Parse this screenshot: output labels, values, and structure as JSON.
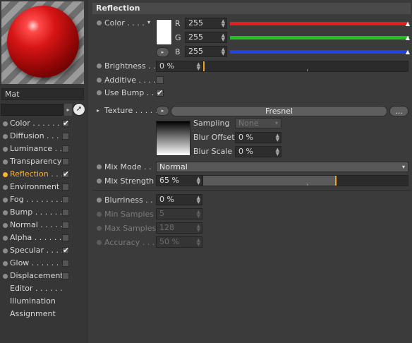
{
  "left": {
    "material_name": "Mat",
    "channels": [
      {
        "label": "Color . . . . . .",
        "checked": true,
        "active": false,
        "has_checkbox": true
      },
      {
        "label": "Diffusion . . .",
        "checked": false,
        "active": false,
        "has_checkbox": true
      },
      {
        "label": "Luminance . .",
        "checked": false,
        "active": false,
        "has_checkbox": true
      },
      {
        "label": "Transparency",
        "checked": false,
        "active": false,
        "has_checkbox": true
      },
      {
        "label": "Reflection . . .",
        "checked": true,
        "active": true,
        "has_checkbox": true
      },
      {
        "label": "Environment",
        "checked": false,
        "active": false,
        "has_checkbox": true
      },
      {
        "label": "Fog . . . . . . . .",
        "checked": false,
        "active": false,
        "has_checkbox": true
      },
      {
        "label": "Bump . . . . . .",
        "checked": false,
        "active": false,
        "has_checkbox": true
      },
      {
        "label": "Normal . . . . .",
        "checked": false,
        "active": false,
        "has_checkbox": true
      },
      {
        "label": "Alpha . . . . . .",
        "checked": false,
        "active": false,
        "has_checkbox": true
      },
      {
        "label": "Specular . . . .",
        "checked": true,
        "active": false,
        "has_checkbox": true
      },
      {
        "label": "Glow . . . . . . .",
        "checked": false,
        "active": false,
        "has_checkbox": true
      },
      {
        "label": "Displacement",
        "checked": false,
        "active": false,
        "has_checkbox": true
      },
      {
        "label": "Editor . . . . . .",
        "checked": false,
        "active": false,
        "has_checkbox": false
      },
      {
        "label": "Illumination",
        "checked": false,
        "active": false,
        "has_checkbox": false
      },
      {
        "label": "Assignment",
        "checked": false,
        "active": false,
        "has_checkbox": false
      }
    ]
  },
  "section": {
    "title": "Reflection"
  },
  "color": {
    "label": "Color . . . .",
    "swatch": "#ffffff",
    "r_label": "R",
    "r_value": "255",
    "g_label": "G",
    "g_value": "255",
    "b_label": "B",
    "b_value": "255",
    "r_color": "#e61e1e",
    "g_color": "#1fc21f",
    "b_color": "#2342e0"
  },
  "brightness": {
    "label": "Brightness . .",
    "value": "0 %",
    "level": 0
  },
  "additive": {
    "label": "Additive . . . .",
    "checked": false
  },
  "use_bump": {
    "label": "Use Bump . .",
    "checked": true
  },
  "texture": {
    "label": "Texture . . . . .",
    "shader": "Fresnel",
    "more": "...",
    "sampling_label": "Sampling",
    "sampling_value": "None",
    "blur_offset_label": "Blur Offset",
    "blur_offset_value": "0 %",
    "blur_scale_label": "Blur Scale",
    "blur_scale_value": "0 %"
  },
  "mix_mode": {
    "label": "Mix Mode . .",
    "value": "Normal"
  },
  "mix_strength": {
    "label": "Mix Strength",
    "value": "65 %",
    "level": 0.65
  },
  "blurriness": {
    "label": "Blurriness . . .",
    "value": "0 %"
  },
  "min_samples": {
    "label": "Min Samples",
    "value": "5"
  },
  "max_samples": {
    "label": "Max Samples",
    "value": "128"
  },
  "accuracy": {
    "label": "Accuracy . . . .",
    "value": "50 %"
  },
  "icons": {
    "check": "✔",
    "spin": "▲▼",
    "arrow_right": "▸",
    "arrow_down": "▾",
    "cursor": "cursor-arrow-icon"
  }
}
